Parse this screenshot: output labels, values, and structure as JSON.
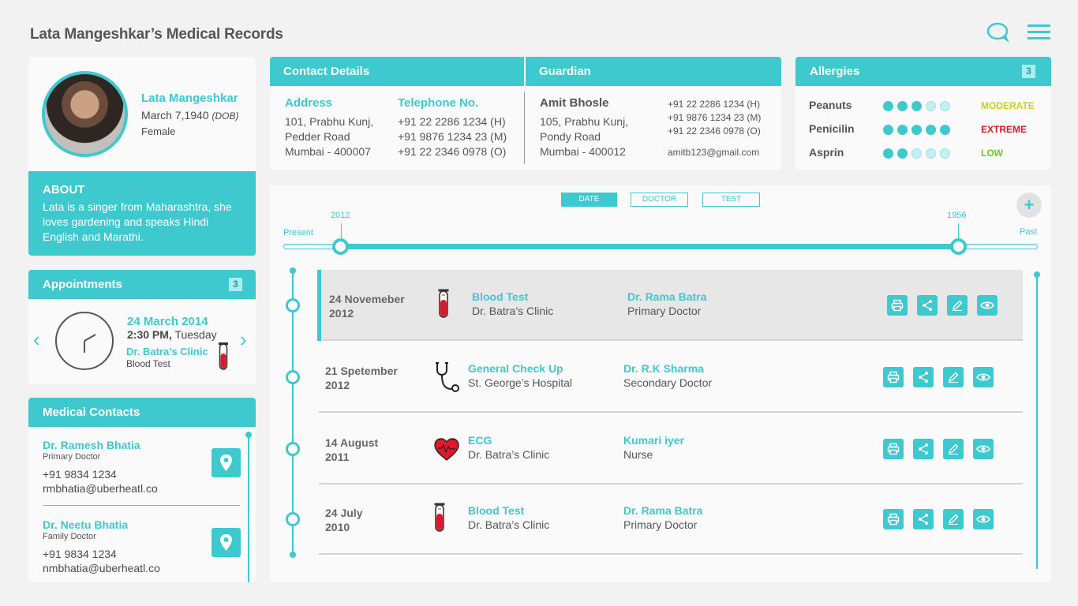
{
  "header": {
    "title": "Lata Mangeshkar’s Medical Records"
  },
  "profile": {
    "name": "Lata Mangeshkar",
    "dob": "March 7,1940",
    "dob_suffix": "(DOB)",
    "gender": "Female",
    "about_title": "ABOUT",
    "about_text": "Lata is a singer from Maharashtra, she loves gardening and speaks Hindi English and Marathi."
  },
  "appointments": {
    "title": "Appointments",
    "count": "3",
    "date": "24  March  2014",
    "time": "2:30 PM,",
    "day": " Tuesday",
    "clinic": "Dr. Batra’s Clinic",
    "test": "Blood Test"
  },
  "medical_contacts": {
    "title": "Medical Contacts",
    "items": [
      {
        "name": "Dr. Ramesh Bhatia",
        "role": "Primary Doctor",
        "phone": "+91 9834 1234",
        "email": "rmbhatia@uberheatl.co"
      },
      {
        "name": "Dr. Neetu Bhatia",
        "role": "Family Doctor",
        "phone": "+91 9834 1234",
        "email": "nmbhatia@uberheatl.co"
      }
    ]
  },
  "contact": {
    "title": "Contact Details",
    "guardian_title": "Guardian",
    "address_label": "Address",
    "address": [
      "101, Prabhu Kunj,",
      "Pedder Road",
      "Mumbai - 400007"
    ],
    "telephone_label": "Telephone No.",
    "telephones": [
      "+91 22 2286 1234 (H)",
      "+91 9876 1234 23 (M)",
      "+91 22 2346 0978 (O)"
    ],
    "guardian_name": "Amit Bhosle",
    "guardian_address": [
      "105, Prabhu Kunj,",
      "Pondy Road",
      "Mumbai - 400012"
    ],
    "guardian_phones": [
      "+91 22 2286 1234 (H)",
      "+91 9876 1234 23 (M)",
      "+91 22 2346 0978 (O)"
    ],
    "guardian_email": "amitb123@gmail.com"
  },
  "allergies": {
    "title": "Allergies",
    "count": "3",
    "items": [
      {
        "name": "Peanuts",
        "level": "MODERATE",
        "score": 3,
        "color": "#c8d020"
      },
      {
        "name": "Penicilin",
        "level": "EXTREME",
        "score": 5,
        "color": "#e0182c"
      },
      {
        "name": "Asprin",
        "level": "LOW",
        "score": 2,
        "color": "#70c81e"
      }
    ]
  },
  "timeline": {
    "filters": [
      "DATE",
      "DOCTOR",
      "TEST"
    ],
    "active_filter": "DATE",
    "add_label": "+",
    "present_label": "Present",
    "past_label": "Past",
    "start_year": "2012",
    "end_year": "1956",
    "records": [
      {
        "date1": "24 Novemeber",
        "date2": "2012",
        "icon": "test-tube-icon",
        "test": "Blood Test",
        "place": "Dr. Batra’s Clinic",
        "doctor": "Dr. Rama Batra",
        "role": "Primary Doctor",
        "selected": true
      },
      {
        "date1": "21 Spetember",
        "date2": "2012",
        "icon": "stethoscope-icon",
        "test": "General Check Up",
        "place": "St. George’s Hospital",
        "doctor": "Dr. R.K Sharma",
        "role": "Secondary Doctor",
        "selected": false
      },
      {
        "date1": "14 August",
        "date2": "2011",
        "icon": "heart-icon",
        "test": "ECG",
        "place": "Dr. Batra’s Clinic",
        "doctor": "Kumari iyer",
        "role": "Nurse",
        "selected": false
      },
      {
        "date1": "24 July",
        "date2": "2010",
        "icon": "test-tube-icon",
        "test": "Blood Test",
        "place": "Dr. Batra’s Clinic",
        "doctor": "Dr. Rama Batra",
        "role": "Primary Doctor",
        "selected": false
      }
    ]
  },
  "colors": {
    "accent": "#3ec9cf",
    "blood": "#e0182c"
  }
}
